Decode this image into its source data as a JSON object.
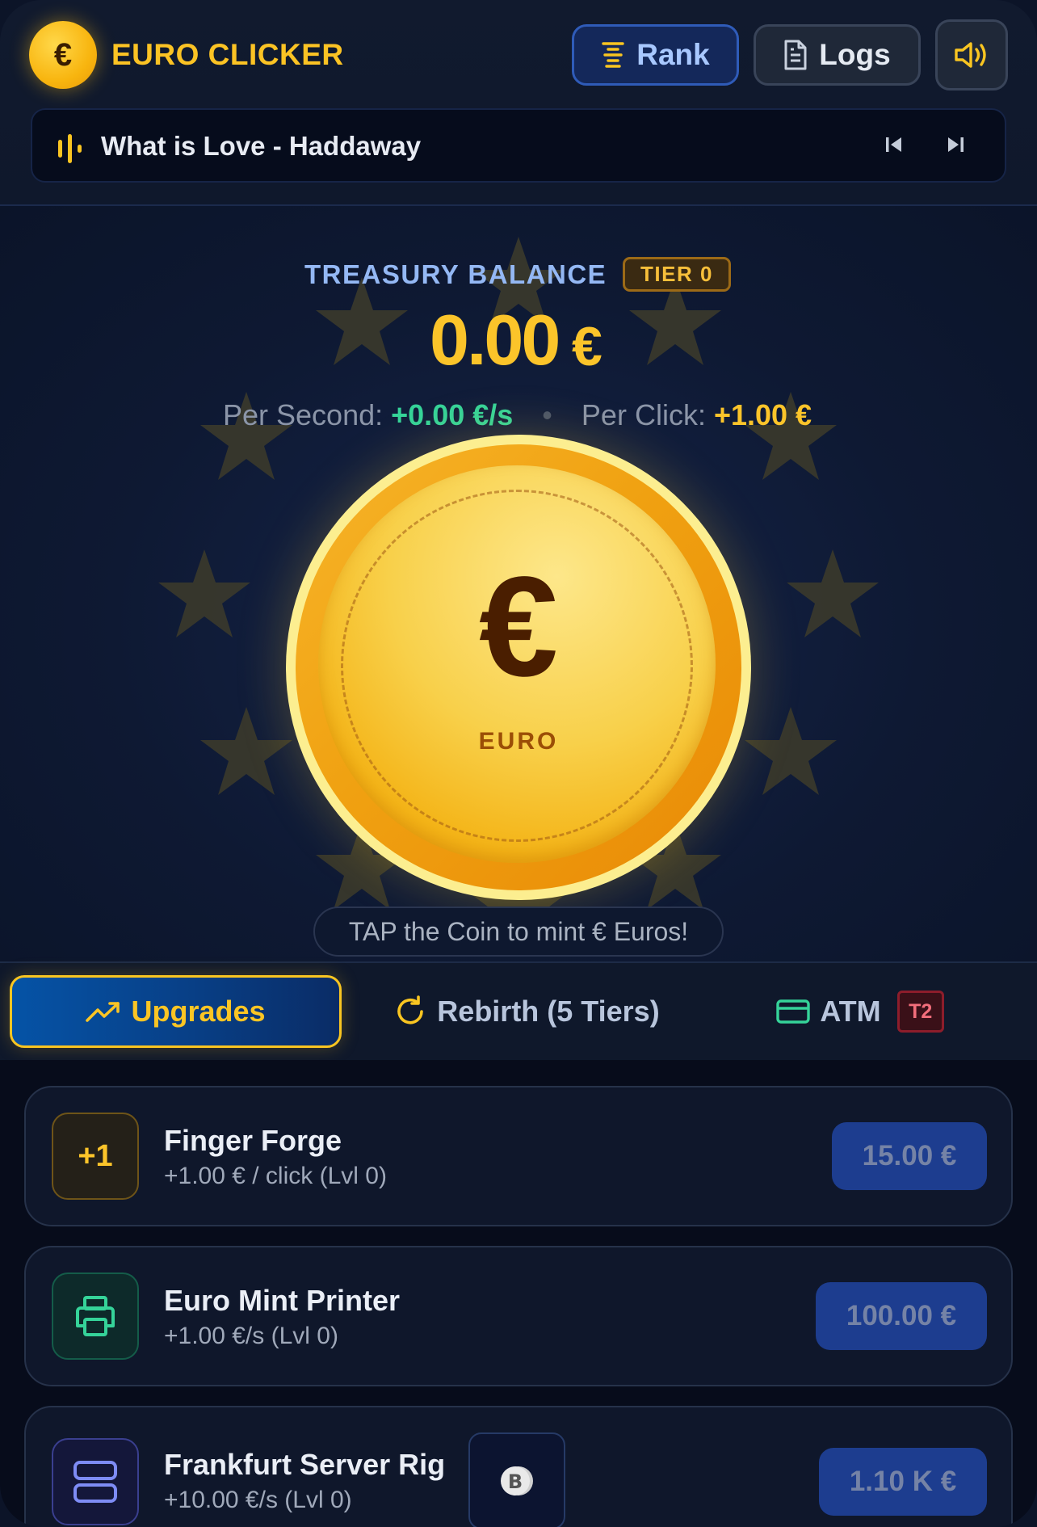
{
  "header": {
    "logo_symbol": "€",
    "title": "EURO CLICKER",
    "rank_label": "Rank",
    "logs_label": "Logs",
    "icons": {
      "rank": "podium-icon",
      "logs": "file-text-icon",
      "sound": "volume-icon"
    }
  },
  "player": {
    "track": "What is Love - Haddaway",
    "icons": {
      "eq": "equalizer-icon",
      "prev": "skip-back-icon",
      "next": "skip-forward-icon"
    }
  },
  "treasury": {
    "label": "TREASURY BALANCE",
    "tier_badge": "TIER 0",
    "balance": "0.00",
    "currency": "€",
    "per_second_label": "Per Second:",
    "per_second_value": "+0.00 €/s",
    "separator": "•",
    "per_click_label": "Per Click:",
    "per_click_value": "+1.00 €"
  },
  "coin": {
    "symbol": "€",
    "text": "EURO",
    "hint": "TAP the Coin to mint € Euros!"
  },
  "tabs": [
    {
      "label": "Upgrades",
      "icon": "trending-up-icon",
      "active": true
    },
    {
      "label": "Rebirth (5 Tiers)",
      "icon": "refresh-icon",
      "active": false
    },
    {
      "label": "ATM",
      "icon": "credit-card-icon",
      "badge": "T2",
      "active": false
    }
  ],
  "upgrades": [
    {
      "title": "Finger Forge",
      "subtitle": "+1.00 € / click (Lvl 0)",
      "icon_text": "+1",
      "icon": "plus-one-icon",
      "price": "15.00 €"
    },
    {
      "title": "Euro Mint Printer",
      "subtitle": "+1.00 €/s (Lvl 0)",
      "icon": "printer-icon",
      "price": "100.00 €"
    },
    {
      "title": "Frankfurt Server Rig",
      "subtitle": "+10.00 €/s (Lvl 0)",
      "icon": "server-icon",
      "extra_icon": "bitcoin-icon",
      "price": "1.10 K €"
    }
  ],
  "colors": {
    "accent_gold": "#fbc42a",
    "green": "#35d399",
    "blue_button": "#1d3d8f",
    "background": "#0d1730"
  }
}
